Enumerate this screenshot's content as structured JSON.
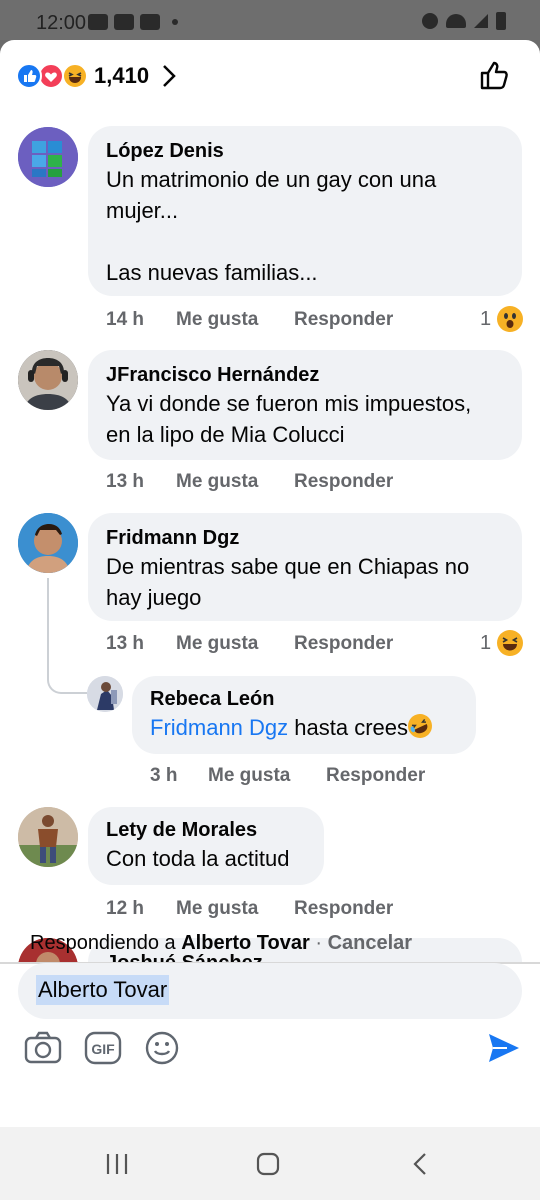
{
  "status": {
    "time": "12:00"
  },
  "reactions": {
    "count": "1,410",
    "icons": [
      "like-icon",
      "love-icon",
      "haha-icon"
    ]
  },
  "comments": [
    {
      "name": "López Denis",
      "text": "Un matrimonio de un gay con una\nmujer...\n\nLas nuevas familias...",
      "time": "14 h",
      "like": "Me gusta",
      "reply": "Responder",
      "reaction_count": "1",
      "reaction_icon": "wow-icon"
    },
    {
      "name": "JFrancisco Hernández",
      "text": "Ya vi donde se fueron mis impuestos,\nen la lipo de Mia Colucci",
      "time": "13 h",
      "like": "Me gusta",
      "reply": "Responder"
    },
    {
      "name": "Fridmann Dgz",
      "text": "De mientras sabe que en Chiapas no\nhay juego",
      "time": "13 h",
      "like": "Me gusta",
      "reply": "Responder",
      "reaction_count": "1",
      "reaction_icon": "haha-icon"
    },
    {
      "name": "Lety de Morales",
      "text": "Con toda la actitud",
      "time": "12 h",
      "like": "Me gusta",
      "reply": "Responder"
    },
    {
      "name": "Joshué Sánchez"
    }
  ],
  "reply": {
    "name": "Rebeca León",
    "mention": "Fridmann Dgz",
    "text": " hasta crees",
    "emoji": "rofl-icon",
    "time": "3 h",
    "like": "Me gusta",
    "reply": "Responder"
  },
  "composer": {
    "replying_prefix": "Respondiendo a ",
    "replying_name": "Alberto Tovar",
    "separator": " · ",
    "cancel": "Cancelar",
    "value": "Alberto Tovar",
    "tools": [
      "camera-icon",
      "gif-icon",
      "emoji-icon",
      "send-icon"
    ]
  },
  "colors": {
    "accent": "#1877f2",
    "bubble": "#f0f2f5",
    "meta": "#65676b"
  }
}
